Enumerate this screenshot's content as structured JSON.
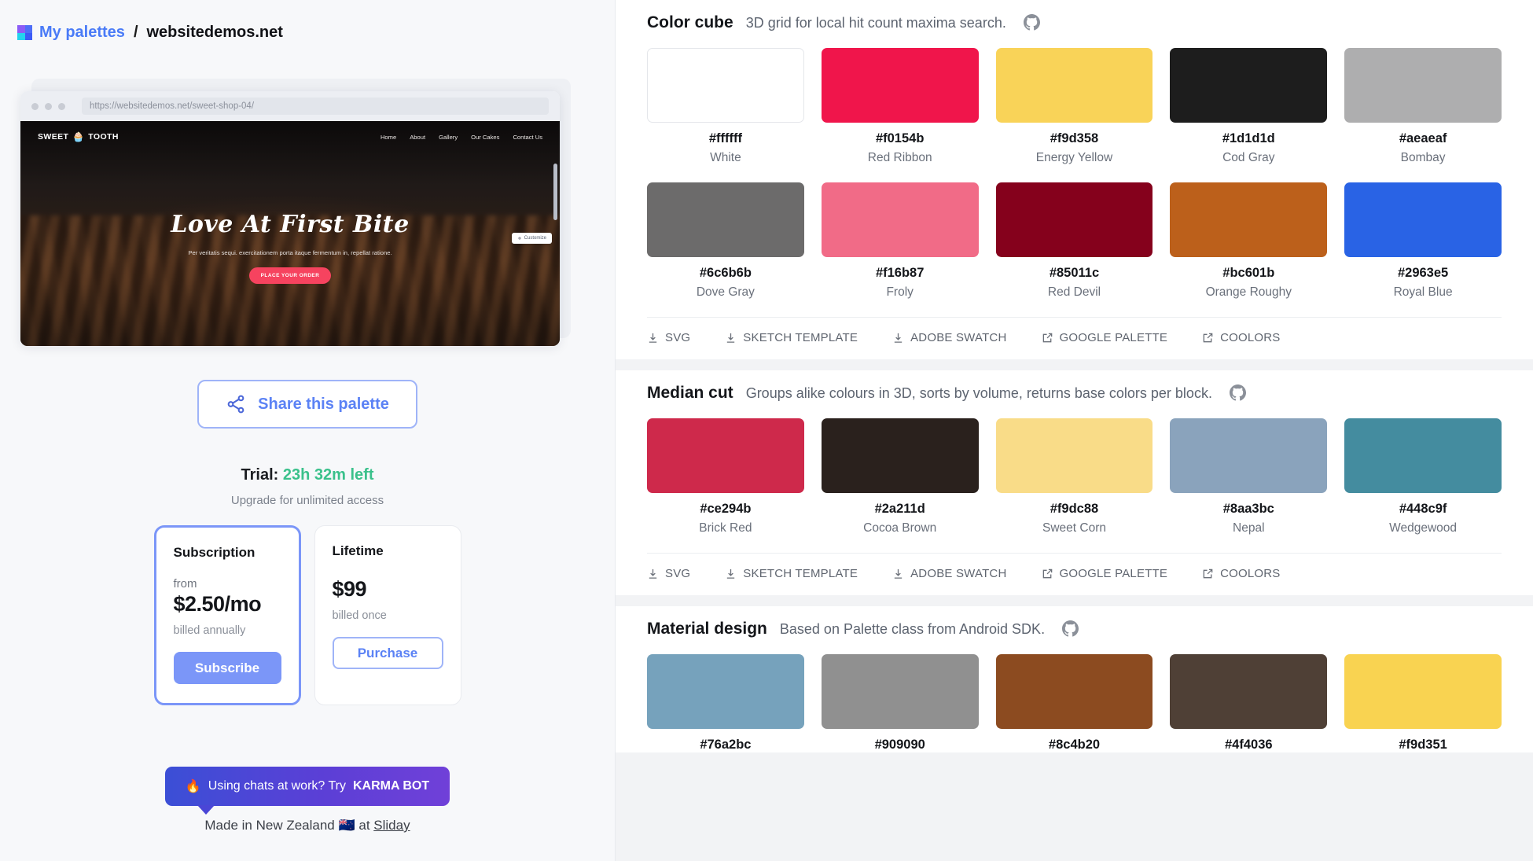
{
  "breadcrumb": {
    "logo_icon": "palette-grid-icon",
    "link_label": "My palettes",
    "separator": "/",
    "current": "websitedemos.net"
  },
  "preview": {
    "url": "https://websitedemos.net/sweet-shop-04/",
    "site": {
      "logo_text_left": "SWEET",
      "logo_icon": "cupcake-icon",
      "logo_text_right": "TOOTH",
      "nav": [
        "Home",
        "About",
        "Gallery",
        "Our Cakes",
        "Contact Us"
      ],
      "hero_title": "Love At First Bite",
      "hero_subtitle": "Per veritatis sequi. exercitationem porta itaque fermentum in, repellat ratione.",
      "hero_button": "PLACE YOUR ORDER",
      "customize_pill": "Customize"
    }
  },
  "share": {
    "icon": "share-nodes-icon",
    "label": "Share this palette"
  },
  "trial": {
    "prefix": "Trial:",
    "time_left": "23h 32m left",
    "subtitle": "Upgrade for unlimited access"
  },
  "pricing": {
    "subscription": {
      "title": "Subscription",
      "from": "from",
      "price": "$2.50/mo",
      "billed": "billed annually",
      "button": "Subscribe"
    },
    "lifetime": {
      "title": "Lifetime",
      "price": "$99",
      "billed": "billed once",
      "button": "Purchase"
    }
  },
  "karma": {
    "emoji": "🔥",
    "text": "Using chats at work? Try ",
    "brand": "KARMA BOT"
  },
  "footer": {
    "made_prefix": "Made in New Zealand ",
    "flag": "🇳🇿",
    "made_mid": " at ",
    "link": "Sliday"
  },
  "export_links": [
    {
      "label": "SVG",
      "icon": "download-icon"
    },
    {
      "label": "SKETCH TEMPLATE",
      "icon": "download-icon"
    },
    {
      "label": "ADOBE SWATCH",
      "icon": "download-icon"
    },
    {
      "label": "GOOGLE PALETTE",
      "icon": "external-link-icon"
    },
    {
      "label": "COOLORS",
      "icon": "external-link-icon"
    }
  ],
  "sections": [
    {
      "title": "Color cube",
      "description": "3D grid for local hit count maxima search.",
      "github_icon": "github-icon",
      "swatches": [
        {
          "hex": "#ffffff",
          "name": "White"
        },
        {
          "hex": "#f0154b",
          "name": "Red Ribbon"
        },
        {
          "hex": "#f9d358",
          "name": "Energy Yellow"
        },
        {
          "hex": "#1d1d1d",
          "name": "Cod Gray"
        },
        {
          "hex": "#aeaeaf",
          "name": "Bombay"
        },
        {
          "hex": "#6c6b6b",
          "name": "Dove Gray"
        },
        {
          "hex": "#f16b87",
          "name": "Froly"
        },
        {
          "hex": "#85011c",
          "name": "Red Devil"
        },
        {
          "hex": "#bc601b",
          "name": "Orange Roughy"
        },
        {
          "hex": "#2963e5",
          "name": "Royal Blue"
        }
      ]
    },
    {
      "title": "Median cut",
      "description": "Groups alike colours in 3D, sorts by volume, returns base colors per block.",
      "github_icon": "github-icon",
      "swatches": [
        {
          "hex": "#ce294b",
          "name": "Brick Red"
        },
        {
          "hex": "#2a211d",
          "name": "Cocoa Brown"
        },
        {
          "hex": "#f9dc88",
          "name": "Sweet Corn"
        },
        {
          "hex": "#8aa3bc",
          "name": "Nepal"
        },
        {
          "hex": "#448c9f",
          "name": "Wedgewood"
        }
      ]
    },
    {
      "title": "Material design",
      "description": "Based on Palette class from Android SDK.",
      "github_icon": "github-icon",
      "swatches": [
        {
          "hex": "#76a2bc",
          "name": ""
        },
        {
          "hex": "#909090",
          "name": ""
        },
        {
          "hex": "#8c4b20",
          "name": ""
        },
        {
          "hex": "#4f4036",
          "name": ""
        },
        {
          "hex": "#f9d351",
          "name": ""
        }
      ]
    }
  ]
}
